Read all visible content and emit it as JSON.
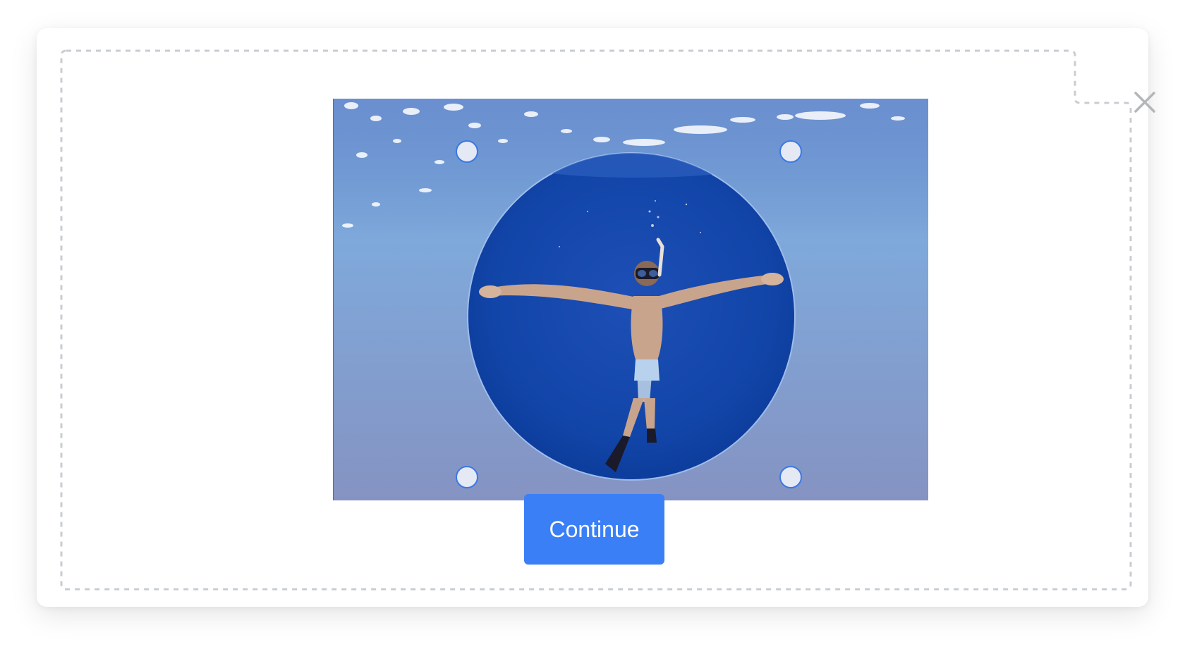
{
  "dialog": {
    "name": "image-crop-dialog",
    "close_icon": "close-icon"
  },
  "cropper": {
    "image_description_icon": "photo-underwater-swimmer",
    "crop_shape": "circle",
    "handles": [
      "top-left",
      "top-right",
      "bottom-left",
      "bottom-right"
    ]
  },
  "actions": {
    "continue_label": "Continue"
  },
  "colors": {
    "accent": "#3a7ff6",
    "handle_fill": "#e4e9f4",
    "handle_border": "#3b78e7",
    "dashed_border": "#c9cdd2",
    "close_icon": "#b3b6ba"
  }
}
